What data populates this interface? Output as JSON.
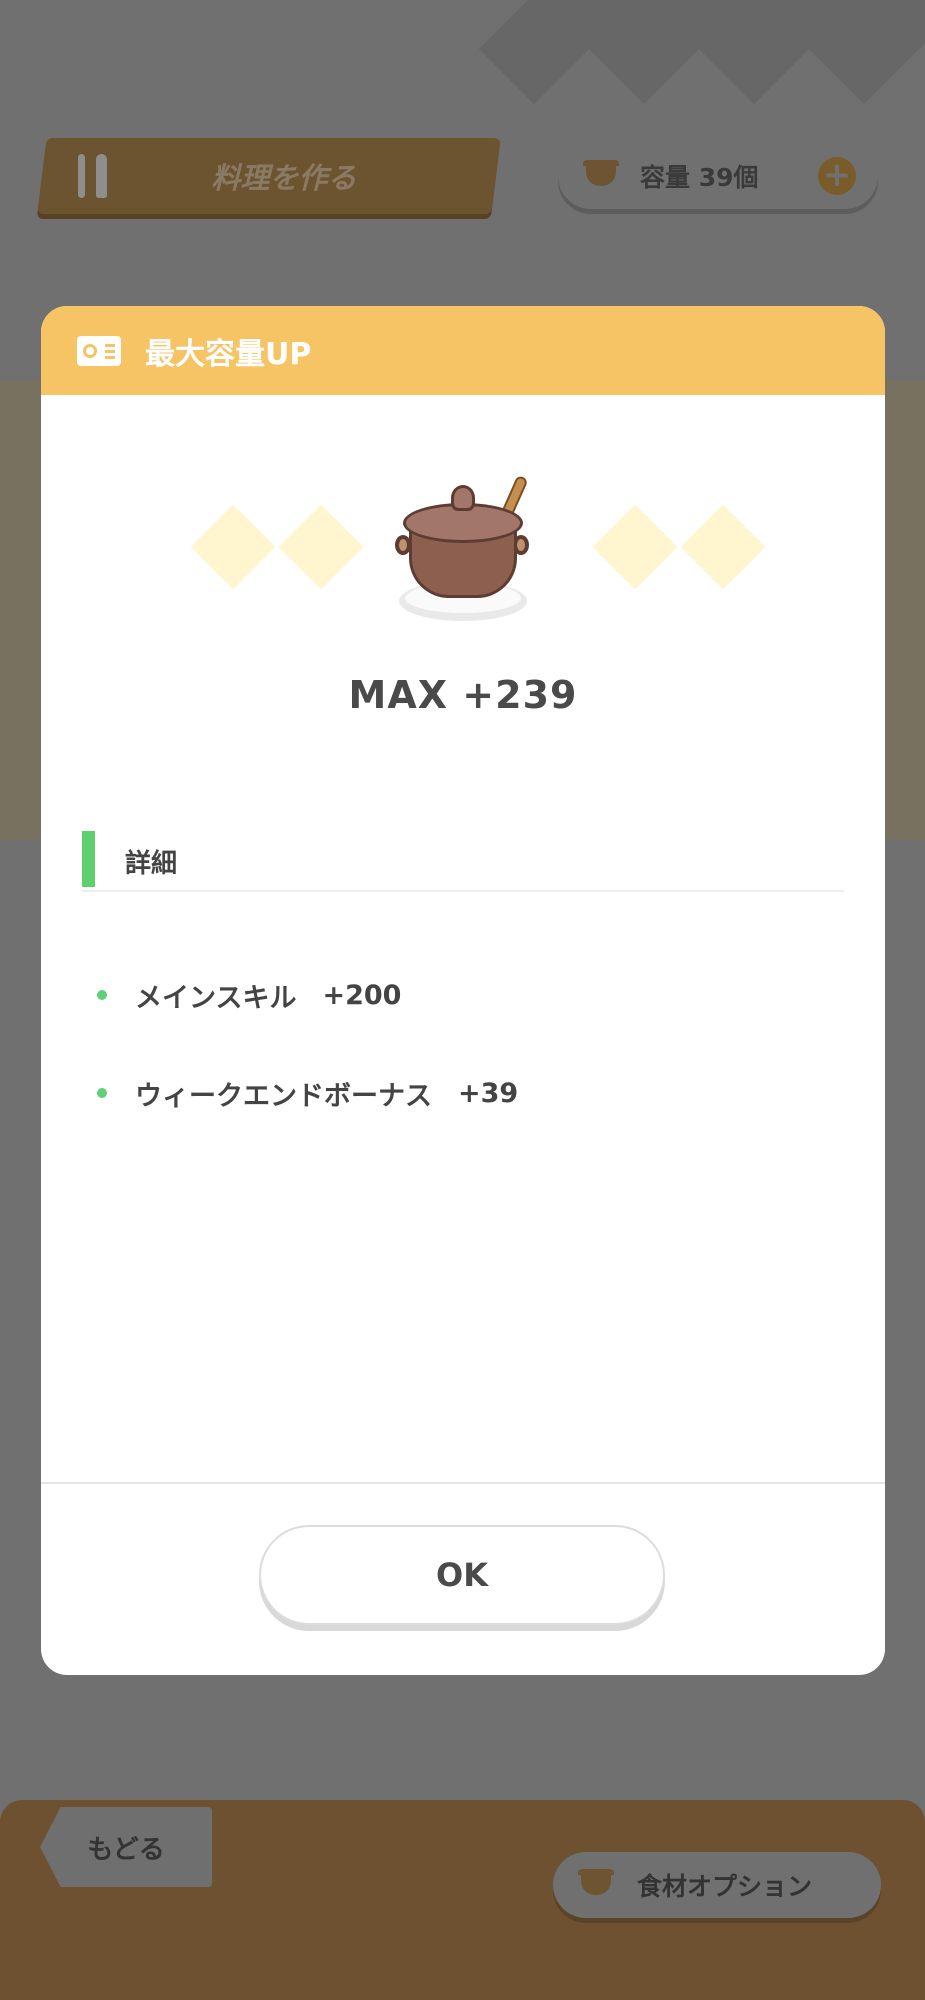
{
  "background": {
    "cook_button_label": "料理を作る",
    "capacity_label": "容量 39個",
    "back_button_label": "もどる",
    "ingredient_option_label": "食材オプション",
    "icons": [
      "cutlery-icon",
      "pot-icon",
      "plus-icon"
    ]
  },
  "modal": {
    "title": "最大容量UP",
    "max_value": "MAX +239",
    "detail_heading": "詳細",
    "bonuses": [
      {
        "name": "メインスキル",
        "value": "+200"
      },
      {
        "name": "ウィークエンドボーナス",
        "value": "+39"
      }
    ],
    "ok_label": "OK"
  },
  "colors": {
    "header": "#f7c465",
    "accent_green": "#5fd070",
    "overlay": "#707070",
    "bottom_bar": "#6d5130"
  }
}
